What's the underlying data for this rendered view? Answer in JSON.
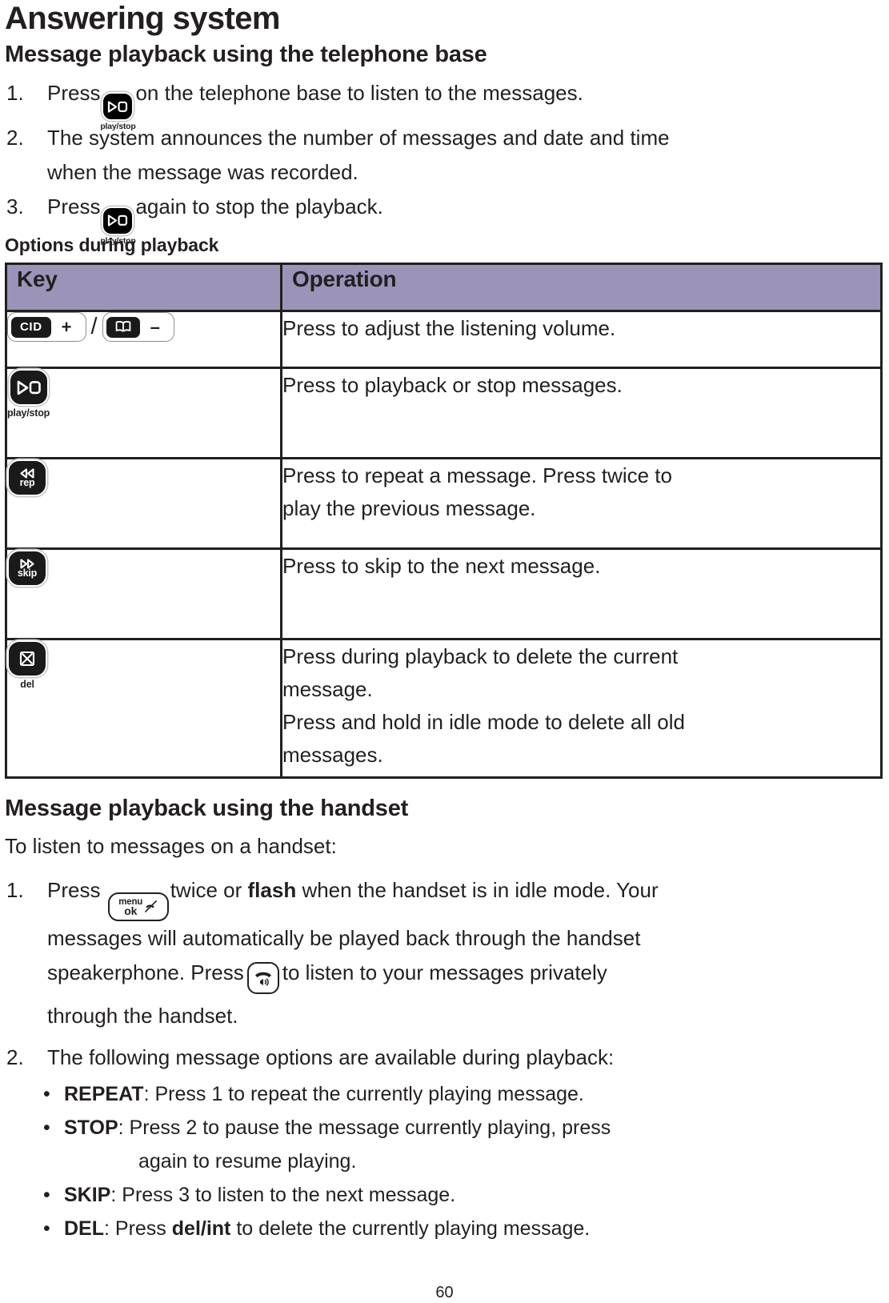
{
  "doc": {
    "title": "Answering system",
    "page_number": "60"
  },
  "section_base": {
    "heading": "Message playback using the telephone base",
    "steps": [
      {
        "num": "1.",
        "before": "Press",
        "icon": "play-stop-key-icon",
        "icon_caption": "play/stop",
        "after": "on the telephone base to listen to the messages."
      },
      {
        "num": "2.",
        "line1": "The system announces the number of messages and date and time",
        "line2": "when the message was recorded."
      },
      {
        "num": "3.",
        "before": "Press",
        "icon": "play-stop-key-icon",
        "icon_caption": "play/stop",
        "after": "again to stop the playback."
      }
    ]
  },
  "options_table": {
    "caption": "Options during playback",
    "headers": [
      "Key",
      "Operation"
    ],
    "rows": [
      {
        "key_type": "volume-pills",
        "key_left_label": "CID",
        "key_left_sign": "+",
        "separator": "/",
        "key_right_icon": "phonebook-icon",
        "key_right_sign": "–",
        "operation": [
          "Press to adjust the listening volume."
        ]
      },
      {
        "key_type": "button",
        "key_icon": "play-stop-key-icon",
        "key_caption": "play/stop",
        "operation": [
          "Press to playback or stop messages."
        ]
      },
      {
        "key_type": "button",
        "key_icon": "rewind-repeat-key-icon",
        "key_label": "rep",
        "operation": [
          "Press to repeat a message. Press twice to",
          "play the previous message."
        ]
      },
      {
        "key_type": "button",
        "key_icon": "fast-forward-skip-key-icon",
        "key_label": "skip",
        "operation": [
          "Press to skip to the next message."
        ]
      },
      {
        "key_type": "button",
        "key_icon": "delete-key-icon",
        "key_caption": "del",
        "operation": [
          "Press during playback to delete the current",
          "message.",
          "Press and hold in idle mode to delete all old",
          "messages."
        ]
      }
    ]
  },
  "section_handset": {
    "heading": "Message playback using the handset",
    "intro": "To listen to messages on a handset:",
    "step1": {
      "num": "1.",
      "t1": "Press",
      "icon1": "menu-ok-key-icon",
      "icon1_top": "menu",
      "icon1_bottom": "ok",
      "t2": "twice or",
      "bold1": "flash",
      "t3": "when the handset is in idle mode. Your",
      "line2": "messages will automatically be played back through the handset",
      "t4": "speakerphone. Press",
      "icon2": "speakerphone-key-icon",
      "t5": "to listen to your messages privately",
      "line4": "through the handset."
    },
    "step2": {
      "num": "2.",
      "text": "The following message options are available during playback:"
    },
    "bullets": [
      {
        "label": "REPEAT",
        "sep": ": ",
        "text": "Press 1 to repeat the currently playing message."
      },
      {
        "label": "STOP",
        "sep": ": ",
        "text": "Press 2 to pause the message currently playing, press",
        "cont": "again to resume playing."
      },
      {
        "label": "SKIP",
        "sep": ": ",
        "text": "Press 3 to listen to the next message."
      },
      {
        "label": "DEL",
        "sep": ": ",
        "pre": "Press ",
        "bold": "del/int",
        "post": " to delete the currently playing message."
      }
    ]
  },
  "colors": {
    "table_header_bg": "#9b94b8",
    "text": "#231f20",
    "key_dark": "#1a1a1a"
  }
}
